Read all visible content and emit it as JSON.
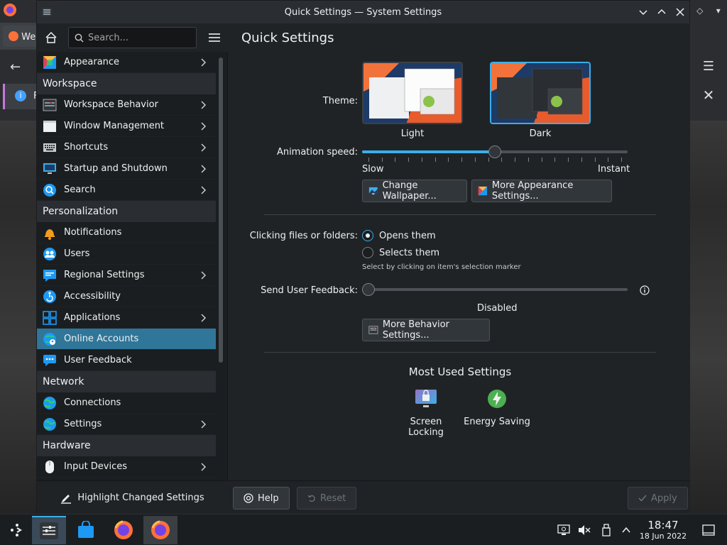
{
  "browser": {
    "tab_label": "We",
    "info_label": "F"
  },
  "window": {
    "title": "Quick Settings — System Settings"
  },
  "sidebar": {
    "search_placeholder": "Search...",
    "items": [
      {
        "type": "item",
        "label": "Appearance",
        "icon": "appearance-icon",
        "chevron": true,
        "selected": false
      },
      {
        "type": "section",
        "label": "Workspace"
      },
      {
        "type": "item",
        "label": "Workspace Behavior",
        "icon": "workspace-behavior-icon",
        "chevron": true,
        "selected": false
      },
      {
        "type": "item",
        "label": "Window Management",
        "icon": "window-management-icon",
        "chevron": true,
        "selected": false
      },
      {
        "type": "item",
        "label": "Shortcuts",
        "icon": "keyboard-icon",
        "chevron": true,
        "selected": false
      },
      {
        "type": "item",
        "label": "Startup and Shutdown",
        "icon": "startup-icon",
        "chevron": true,
        "selected": false
      },
      {
        "type": "item",
        "label": "Search",
        "icon": "search-icon",
        "chevron": true,
        "selected": false
      },
      {
        "type": "section",
        "label": "Personalization"
      },
      {
        "type": "item",
        "label": "Notifications",
        "icon": "bell-icon",
        "chevron": false,
        "selected": false
      },
      {
        "type": "item",
        "label": "Users",
        "icon": "users-icon",
        "chevron": false,
        "selected": false
      },
      {
        "type": "item",
        "label": "Regional Settings",
        "icon": "regional-icon",
        "chevron": true,
        "selected": false
      },
      {
        "type": "item",
        "label": "Accessibility",
        "icon": "accessibility-icon",
        "chevron": false,
        "selected": false
      },
      {
        "type": "item",
        "label": "Applications",
        "icon": "applications-icon",
        "chevron": true,
        "selected": false
      },
      {
        "type": "item",
        "label": "Online Accounts",
        "icon": "online-accounts-icon",
        "chevron": false,
        "selected": true
      },
      {
        "type": "item",
        "label": "User Feedback",
        "icon": "feedback-icon",
        "chevron": false,
        "selected": false
      },
      {
        "type": "section",
        "label": "Network"
      },
      {
        "type": "item",
        "label": "Connections",
        "icon": "globe-icon",
        "chevron": false,
        "selected": false
      },
      {
        "type": "item",
        "label": "Settings",
        "icon": "globe-icon",
        "chevron": true,
        "selected": false
      },
      {
        "type": "section",
        "label": "Hardware"
      },
      {
        "type": "item",
        "label": "Input Devices",
        "icon": "mouse-icon",
        "chevron": true,
        "selected": false
      }
    ],
    "footer_label": "Highlight Changed Settings"
  },
  "main": {
    "title": "Quick Settings",
    "theme_label": "Theme:",
    "theme_light": "Light",
    "theme_dark": "Dark",
    "animation_label": "Animation speed:",
    "animation_value": 0.5,
    "slow_label": "Slow",
    "instant_label": "Instant",
    "change_wallpaper": "Change Wallpaper...",
    "more_appearance": "More Appearance Settings...",
    "clicking_label": "Clicking files or folders:",
    "opens_them": "Opens them",
    "selects_them": "Selects them",
    "select_hint": "Select by clicking on item's selection marker",
    "feedback_label": "Send User Feedback:",
    "feedback_value": "Disabled",
    "more_behavior": "More Behavior Settings...",
    "most_used_title": "Most Used Settings",
    "most_used": [
      {
        "label": "Screen Locking",
        "icon": "screen-lock-icon"
      },
      {
        "label": "Energy Saving",
        "icon": "energy-icon"
      }
    ],
    "help": "Help",
    "reset": "Reset",
    "apply": "Apply"
  },
  "taskbar": {
    "time": "18:47",
    "date": "18 Jun 2022"
  },
  "colors": {
    "accent": "#3daee9",
    "selected": "#2f7699",
    "window_bg": "#202326"
  }
}
